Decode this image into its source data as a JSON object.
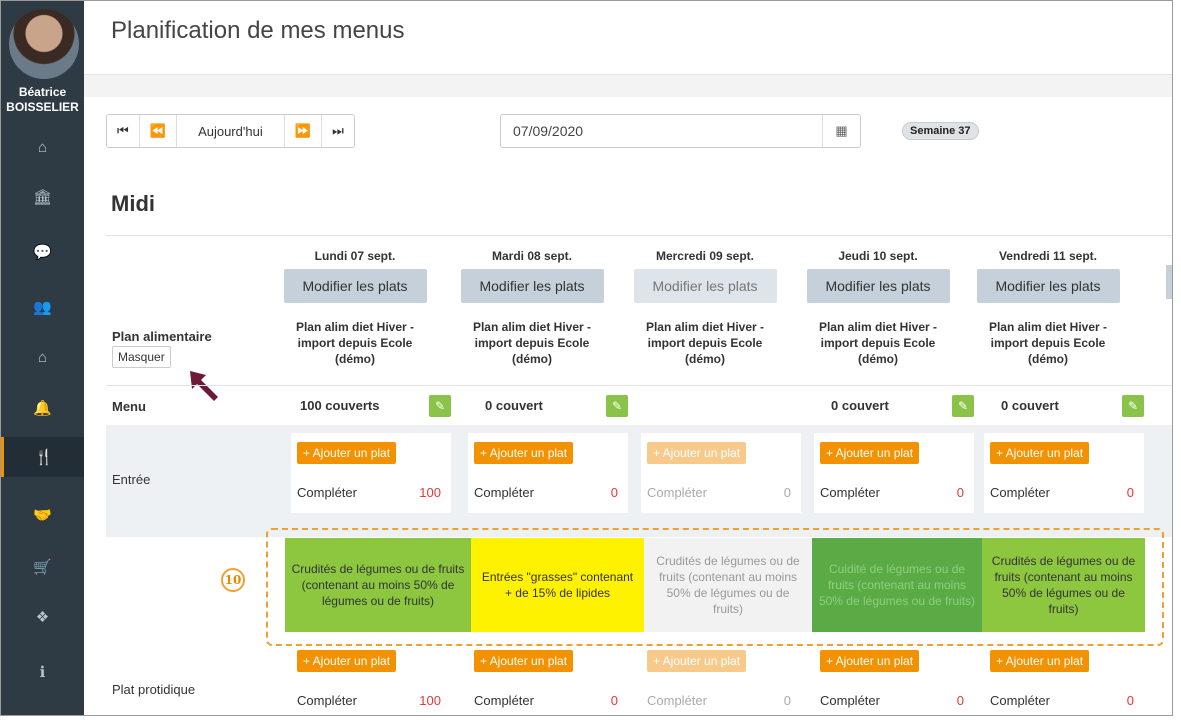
{
  "user": {
    "first_name": "Béatrice",
    "last_name": "BOISSELIER"
  },
  "sidebar": {
    "items": [
      {
        "icon": "home-icon",
        "glyph": "⌂"
      },
      {
        "icon": "bank-icon",
        "glyph": "🏛"
      },
      {
        "icon": "comments-icon",
        "glyph": "💬"
      },
      {
        "icon": "users-icon",
        "glyph": "👥"
      },
      {
        "icon": "home-icon",
        "glyph": "⌂"
      },
      {
        "icon": "bell-icon",
        "glyph": "🔔"
      },
      {
        "icon": "cutlery-icon",
        "glyph": "🍴",
        "active": true
      },
      {
        "icon": "handshake-icon",
        "glyph": "🤝"
      },
      {
        "icon": "cart-icon",
        "glyph": "🛒"
      },
      {
        "icon": "cubes-icon",
        "glyph": "❖"
      },
      {
        "icon": "info-icon",
        "glyph": "ℹ"
      }
    ]
  },
  "header": {
    "title": "Planification de mes menus"
  },
  "toolbar": {
    "first": "⏮",
    "prev": "⏪",
    "today": "Aujourd'hui",
    "next": "⏩",
    "last": "⏭",
    "date": "07/09/2020",
    "calendar_glyph": "▦",
    "week": "Semaine 37"
  },
  "section": {
    "title": "Midi"
  },
  "rows": {
    "plan_label": "Plan alimentaire",
    "hide_label": "Masquer",
    "menu_label": "Menu",
    "entree_label": "Entrée",
    "plat_label": "Plat protidique"
  },
  "days": [
    {
      "label": "Lundi 07 sept.",
      "modify": "Modifier les plats",
      "plan": "Plan alim diet Hiver - import depuis Ecole (démo)",
      "couverts": "100 couverts",
      "add": "+ Ajouter un plat",
      "complete": "Compléter",
      "entree_count": "100",
      "plat_count": "100"
    },
    {
      "label": "Mardi 08 sept.",
      "modify": "Modifier les plats",
      "plan": "Plan alim diet Hiver - import depuis Ecole (démo)",
      "couverts": "0 couvert",
      "add": "+ Ajouter un plat",
      "complete": "Compléter",
      "entree_count": "0",
      "plat_count": "0"
    },
    {
      "label": "Mercredi 09 sept.",
      "modify": "Modifier les plats",
      "plan": "Plan alim diet Hiver - import depuis Ecole (démo)",
      "couverts": "",
      "add": "+ Ajouter un plat",
      "complete": "Compléter",
      "entree_count": "0",
      "plat_count": "0"
    },
    {
      "label": "Jeudi 10 sept.",
      "modify": "Modifier les plats",
      "plan": "Plan alim diet Hiver - import depuis Ecole (démo)",
      "couverts": "0 couvert",
      "add": "+ Ajouter un plat",
      "complete": "Compléter",
      "entree_count": "0",
      "plat_count": "0"
    },
    {
      "label": "Vendredi 11 sept.",
      "modify": "Modifier les plats",
      "plan": "Plan alim diet Hiver - import depuis Ecole (démo)",
      "couverts": "0 couvert",
      "add": "+ Ajouter un plat",
      "complete": "Compléter",
      "entree_count": "0",
      "plat_count": "0"
    }
  ],
  "categories": [
    {
      "text": "Crudités de légumes ou de fruits (contenant au moins 50% de légumes ou de fruits)",
      "bg": "#8dc63f",
      "color": "#333333"
    },
    {
      "text": "Entrées \"grasses\" contenant + de 15% de lipides",
      "bg": "#fff200",
      "color": "#333333"
    },
    {
      "text": "Crudités de légumes ou de fruits (contenant au moins 50% de légumes ou de fruits)",
      "bg": "#f2f2f2",
      "color": "#999999"
    },
    {
      "text": "Cuidité de légumes ou de fruits (contenant au moins 50% de légumes ou de fruits)",
      "bg": "#5aab46",
      "color": "#8fcf7a"
    },
    {
      "text": "Crudités de légumes ou de fruits (contenant au moins 50% de légumes ou de fruits)",
      "bg": "#8dc63f",
      "color": "#333333"
    }
  ],
  "callout": {
    "number": "10"
  },
  "colors": {
    "sidebar": "#2e3a44",
    "accent": "#f39200",
    "edit": "#8bc34a",
    "alert": "#e53935"
  }
}
